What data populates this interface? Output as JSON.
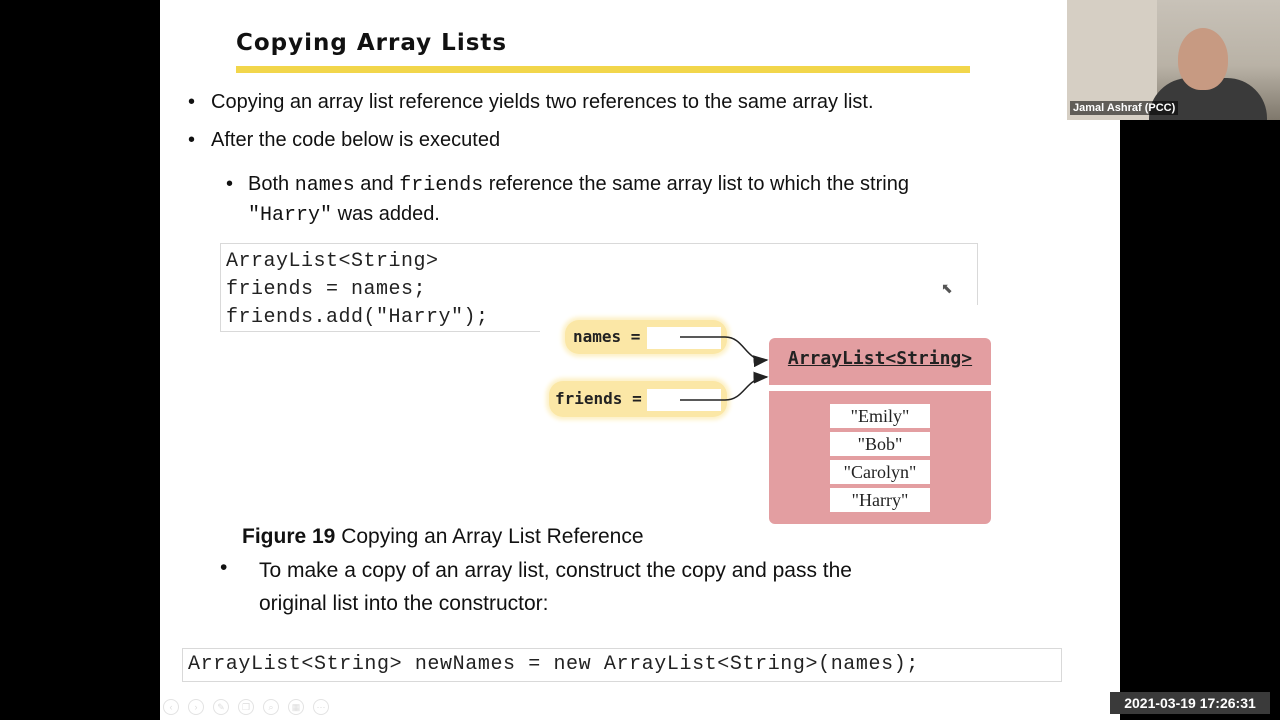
{
  "slide": {
    "title": "Copying Array Lists",
    "bullets": [
      "Copying an array list reference yields two references to the same array list.",
      "After the code below is executed"
    ],
    "sub_bullet": {
      "part1": "Both ",
      "code1": "names",
      "part2": " and ",
      "code2": "friends",
      "part3": " reference the same array list to which the string",
      "code3": "\"Harry\"",
      "part4": " was added."
    },
    "code_block_1": [
      "ArrayList<String>",
      "friends = names;",
      "friends.add(\"Harry\");"
    ],
    "diagram": {
      "var_names": "names =",
      "var_friends": "friends =",
      "object_title": "ArrayList<String>",
      "elements": [
        "\"Emily\"",
        "\"Bob\"",
        "\"Carolyn\"",
        "\"Harry\""
      ]
    },
    "caption": {
      "bold": "Figure 19",
      "text": " Copying an Array List Reference"
    },
    "bullet3": {
      "line1": "To make a copy of an array list, construct the copy and pass the",
      "line2": "original list into  the constructor:"
    },
    "code_block_2": "ArrayList<String> newNames = new ArrayList<String>(names);"
  },
  "webcam": {
    "participant_name": "Jamal Ashraf (PCC)"
  },
  "timestamp": "2021-03-19  17:26:31",
  "toolbar": {
    "buttons": [
      "prev-icon",
      "next-icon",
      "pen-icon",
      "copy-icon",
      "zoom-icon",
      "slides-icon",
      "more-icon"
    ]
  },
  "colors": {
    "title_underline": "#f2d64b",
    "variable_box": "#fbe7a6",
    "object_box": "#e39ea1"
  }
}
